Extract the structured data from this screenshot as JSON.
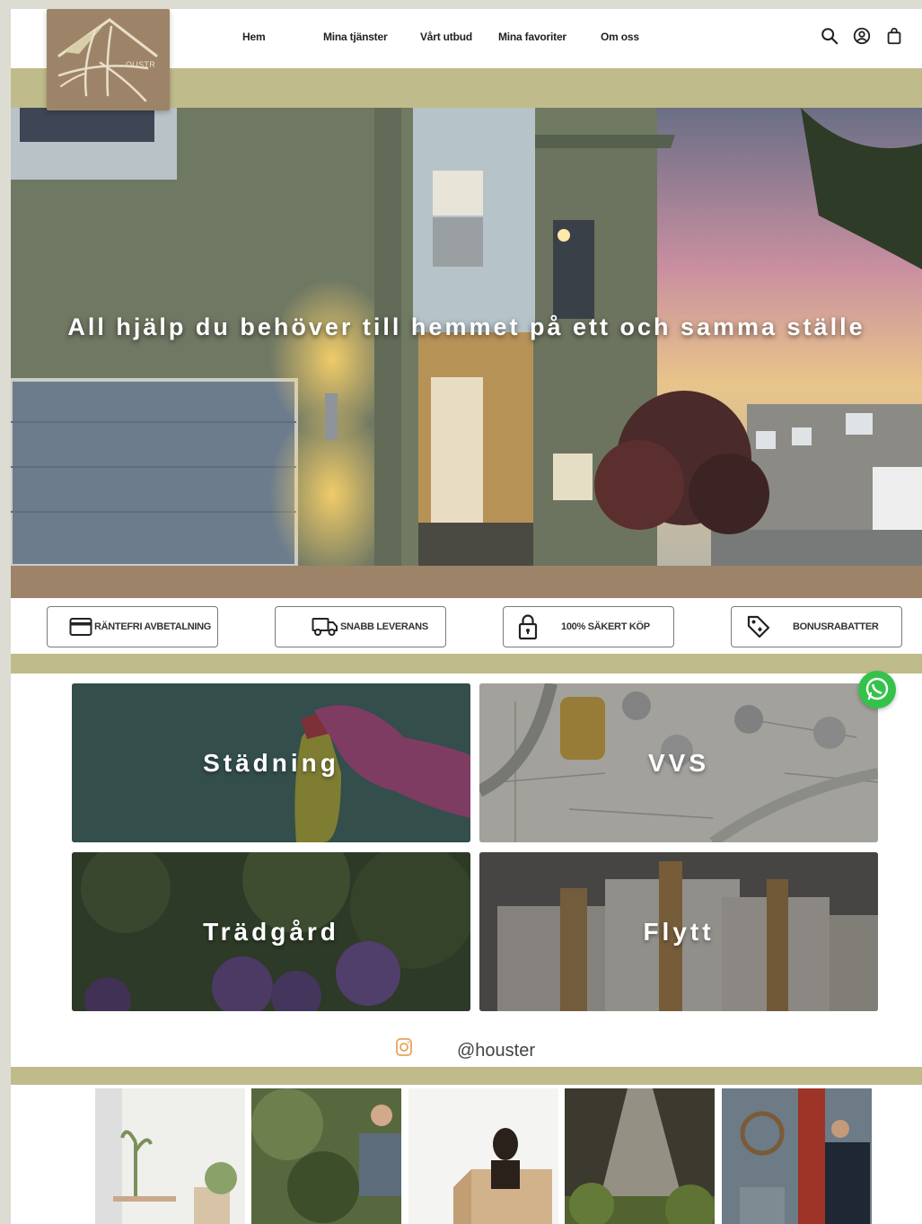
{
  "logo": {
    "text": "OUSTR"
  },
  "nav": {
    "links": [
      "Hem",
      "Mina tjänster",
      "Vårt utbud",
      "Mina favoriter",
      "Om oss"
    ],
    "icons": [
      "search-icon",
      "account-icon",
      "shopping-bag-icon"
    ]
  },
  "hero": {
    "title": "All hjälp du behöver till hemmet på ett och samma ställe"
  },
  "features": [
    {
      "label": "RÄNTEFRI AVBETALNING",
      "icon": "credit-card-icon"
    },
    {
      "label": "SNABB LEVERANS",
      "icon": "delivery-truck-icon"
    },
    {
      "label": "100% SÄKERT KÖP",
      "icon": "lock-icon"
    },
    {
      "label": "BONUSRABATTER",
      "icon": "price-tag-icon"
    }
  ],
  "services": [
    "Städning",
    "VVS",
    "Trädgård",
    "Flytt"
  ],
  "instagram": {
    "handle": "@houster",
    "icon": "instagram-icon"
  },
  "colors": {
    "olive": "#c0bb8a",
    "brown": "#9d8468",
    "whatsapp": "#35c24a"
  }
}
